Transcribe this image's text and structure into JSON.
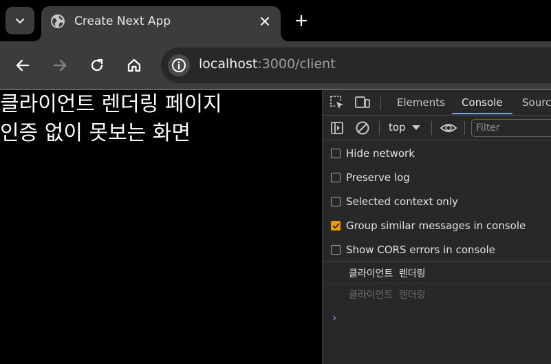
{
  "browser": {
    "tab": {
      "title": "Create Next App",
      "favicon": "globe-icon"
    },
    "address": {
      "host": "localhost",
      "rest": ":3000/client"
    }
  },
  "page": {
    "lines": [
      "클라이언트 렌더링 페이지",
      "인증 없이 못보는 화면"
    ]
  },
  "devtools": {
    "tabs": [
      {
        "label": "Elements",
        "active": false
      },
      {
        "label": "Console",
        "active": true
      },
      {
        "label": "Sources",
        "active": false
      }
    ],
    "console_toolbar": {
      "context": "top",
      "filter_placeholder": "Filter"
    },
    "settings": [
      {
        "label": "Hide network",
        "checked": false
      },
      {
        "label": "Preserve log",
        "checked": false
      },
      {
        "label": "Selected context only",
        "checked": false
      },
      {
        "label": "Group similar messages in console",
        "checked": true
      },
      {
        "label": "Show CORS errors in console",
        "checked": false
      }
    ],
    "messages": [
      {
        "text": "클라이언트 렌더링",
        "dimmed": false
      },
      {
        "text": "클라이언트 렌더링",
        "dimmed": true
      }
    ],
    "prompt": "›"
  },
  "colors": {
    "accent_blue": "#7cacf8",
    "checkbox_orange": "#f29900",
    "toolbar_bg": "#3c3c3c",
    "devtools_bg": "#282828"
  }
}
